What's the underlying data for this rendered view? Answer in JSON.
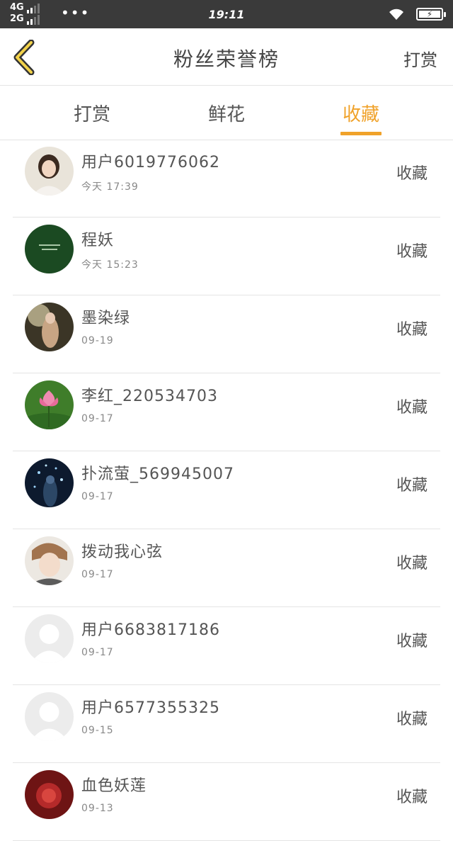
{
  "status_bar": {
    "network_top": "4G",
    "network_bottom": "2G",
    "dots": "•••",
    "time": "19:11",
    "battery_icon": "battery-charging-icon",
    "wifi_icon": "wifi-icon"
  },
  "header": {
    "title": "粉丝荣誉榜",
    "action": "打赏",
    "back_icon": "chevron-left-icon"
  },
  "tabs": [
    {
      "label": "打赏",
      "active": false
    },
    {
      "label": "鲜花",
      "active": false
    },
    {
      "label": "收藏",
      "active": true
    }
  ],
  "accent_color": "#f0a22a",
  "items": [
    {
      "name": "用户6019776062",
      "time": "今天 17:39",
      "action": "收藏"
    },
    {
      "name": "程妖",
      "time": "今天 15:23",
      "action": "收藏"
    },
    {
      "name": "墨染绿",
      "time": "09-19",
      "action": "收藏"
    },
    {
      "name": "李红_220534703",
      "time": "09-17",
      "action": "收藏"
    },
    {
      "name": "扑流萤_569945007",
      "time": "09-17",
      "action": "收藏"
    },
    {
      "name": "拨动我心弦",
      "time": "09-17",
      "action": "收藏"
    },
    {
      "name": "用户6683817186",
      "time": "09-17",
      "action": "收藏"
    },
    {
      "name": "用户6577355325",
      "time": "09-15",
      "action": "收藏"
    },
    {
      "name": "血色妖莲",
      "time": "09-13",
      "action": "收藏"
    }
  ]
}
